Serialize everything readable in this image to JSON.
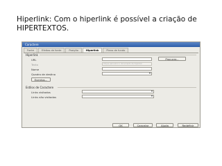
{
  "heading": "Hiperlink: Com o hiperlink é possível a criação de HIPERTEXTOS.",
  "dialog": {
    "title": "Caractere",
    "tabs": [
      {
        "label": "Fonte"
      },
      {
        "label": "Efeitos de fonte"
      },
      {
        "label": "Posição"
      },
      {
        "label": "Hiperlink",
        "active": true
      },
      {
        "label": "Plano de fundo"
      }
    ],
    "hyperlink_group": {
      "title": "Hiperlink",
      "url_label": "URL",
      "text_label": "Texto",
      "text_value": "Clique para abrir o documento de hiperlink",
      "name_label": "Nome",
      "frame_label": "Quadro de destino",
      "browse_button": "Procurar...",
      "events_button": "Eventos..."
    },
    "char_styles_group": {
      "title": "Estilos de Caractere",
      "visited_label": "Links visitados",
      "unvisited_label": "Links não visitados"
    },
    "buttons": {
      "ok": "OK",
      "cancel": "Cancelar",
      "help": "Ajuda",
      "reset": "Redefinir"
    }
  }
}
